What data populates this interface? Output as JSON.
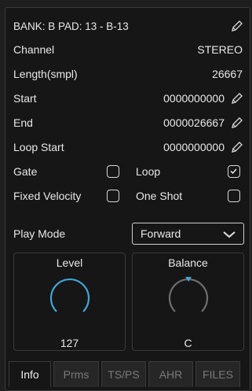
{
  "header": {
    "title": "BANK: B PAD: 13 - B-13",
    "edit_icon": "pencil-icon"
  },
  "fields": {
    "channel": {
      "label": "Channel",
      "value": "STEREO"
    },
    "length": {
      "label": "Length(smpl)",
      "value": "26667"
    },
    "start": {
      "label": "Start",
      "value": "0000000000"
    },
    "end": {
      "label": "End",
      "value": "0000026667"
    },
    "loop_start": {
      "label": "Loop Start",
      "value": "0000000000"
    }
  },
  "toggles": {
    "gate": {
      "label": "Gate",
      "checked": false
    },
    "loop": {
      "label": "Loop",
      "checked": true
    },
    "fixed_velocity": {
      "label": "Fixed Velocity",
      "checked": false
    },
    "one_shot": {
      "label": "One Shot",
      "checked": false
    }
  },
  "play_mode": {
    "label": "Play Mode",
    "value": "Forward"
  },
  "knobs": {
    "level": {
      "label": "Level",
      "value": "127",
      "color": "#3fa7d6"
    },
    "balance": {
      "label": "Balance",
      "value": "C",
      "marker_color": "#3fa7d6"
    }
  },
  "tabs": [
    {
      "label": "Info",
      "active": true
    },
    {
      "label": "Prms",
      "active": false
    },
    {
      "label": "TS/PS",
      "active": false
    },
    {
      "label": "AHR",
      "active": false
    },
    {
      "label": "FILES",
      "active": false
    }
  ]
}
